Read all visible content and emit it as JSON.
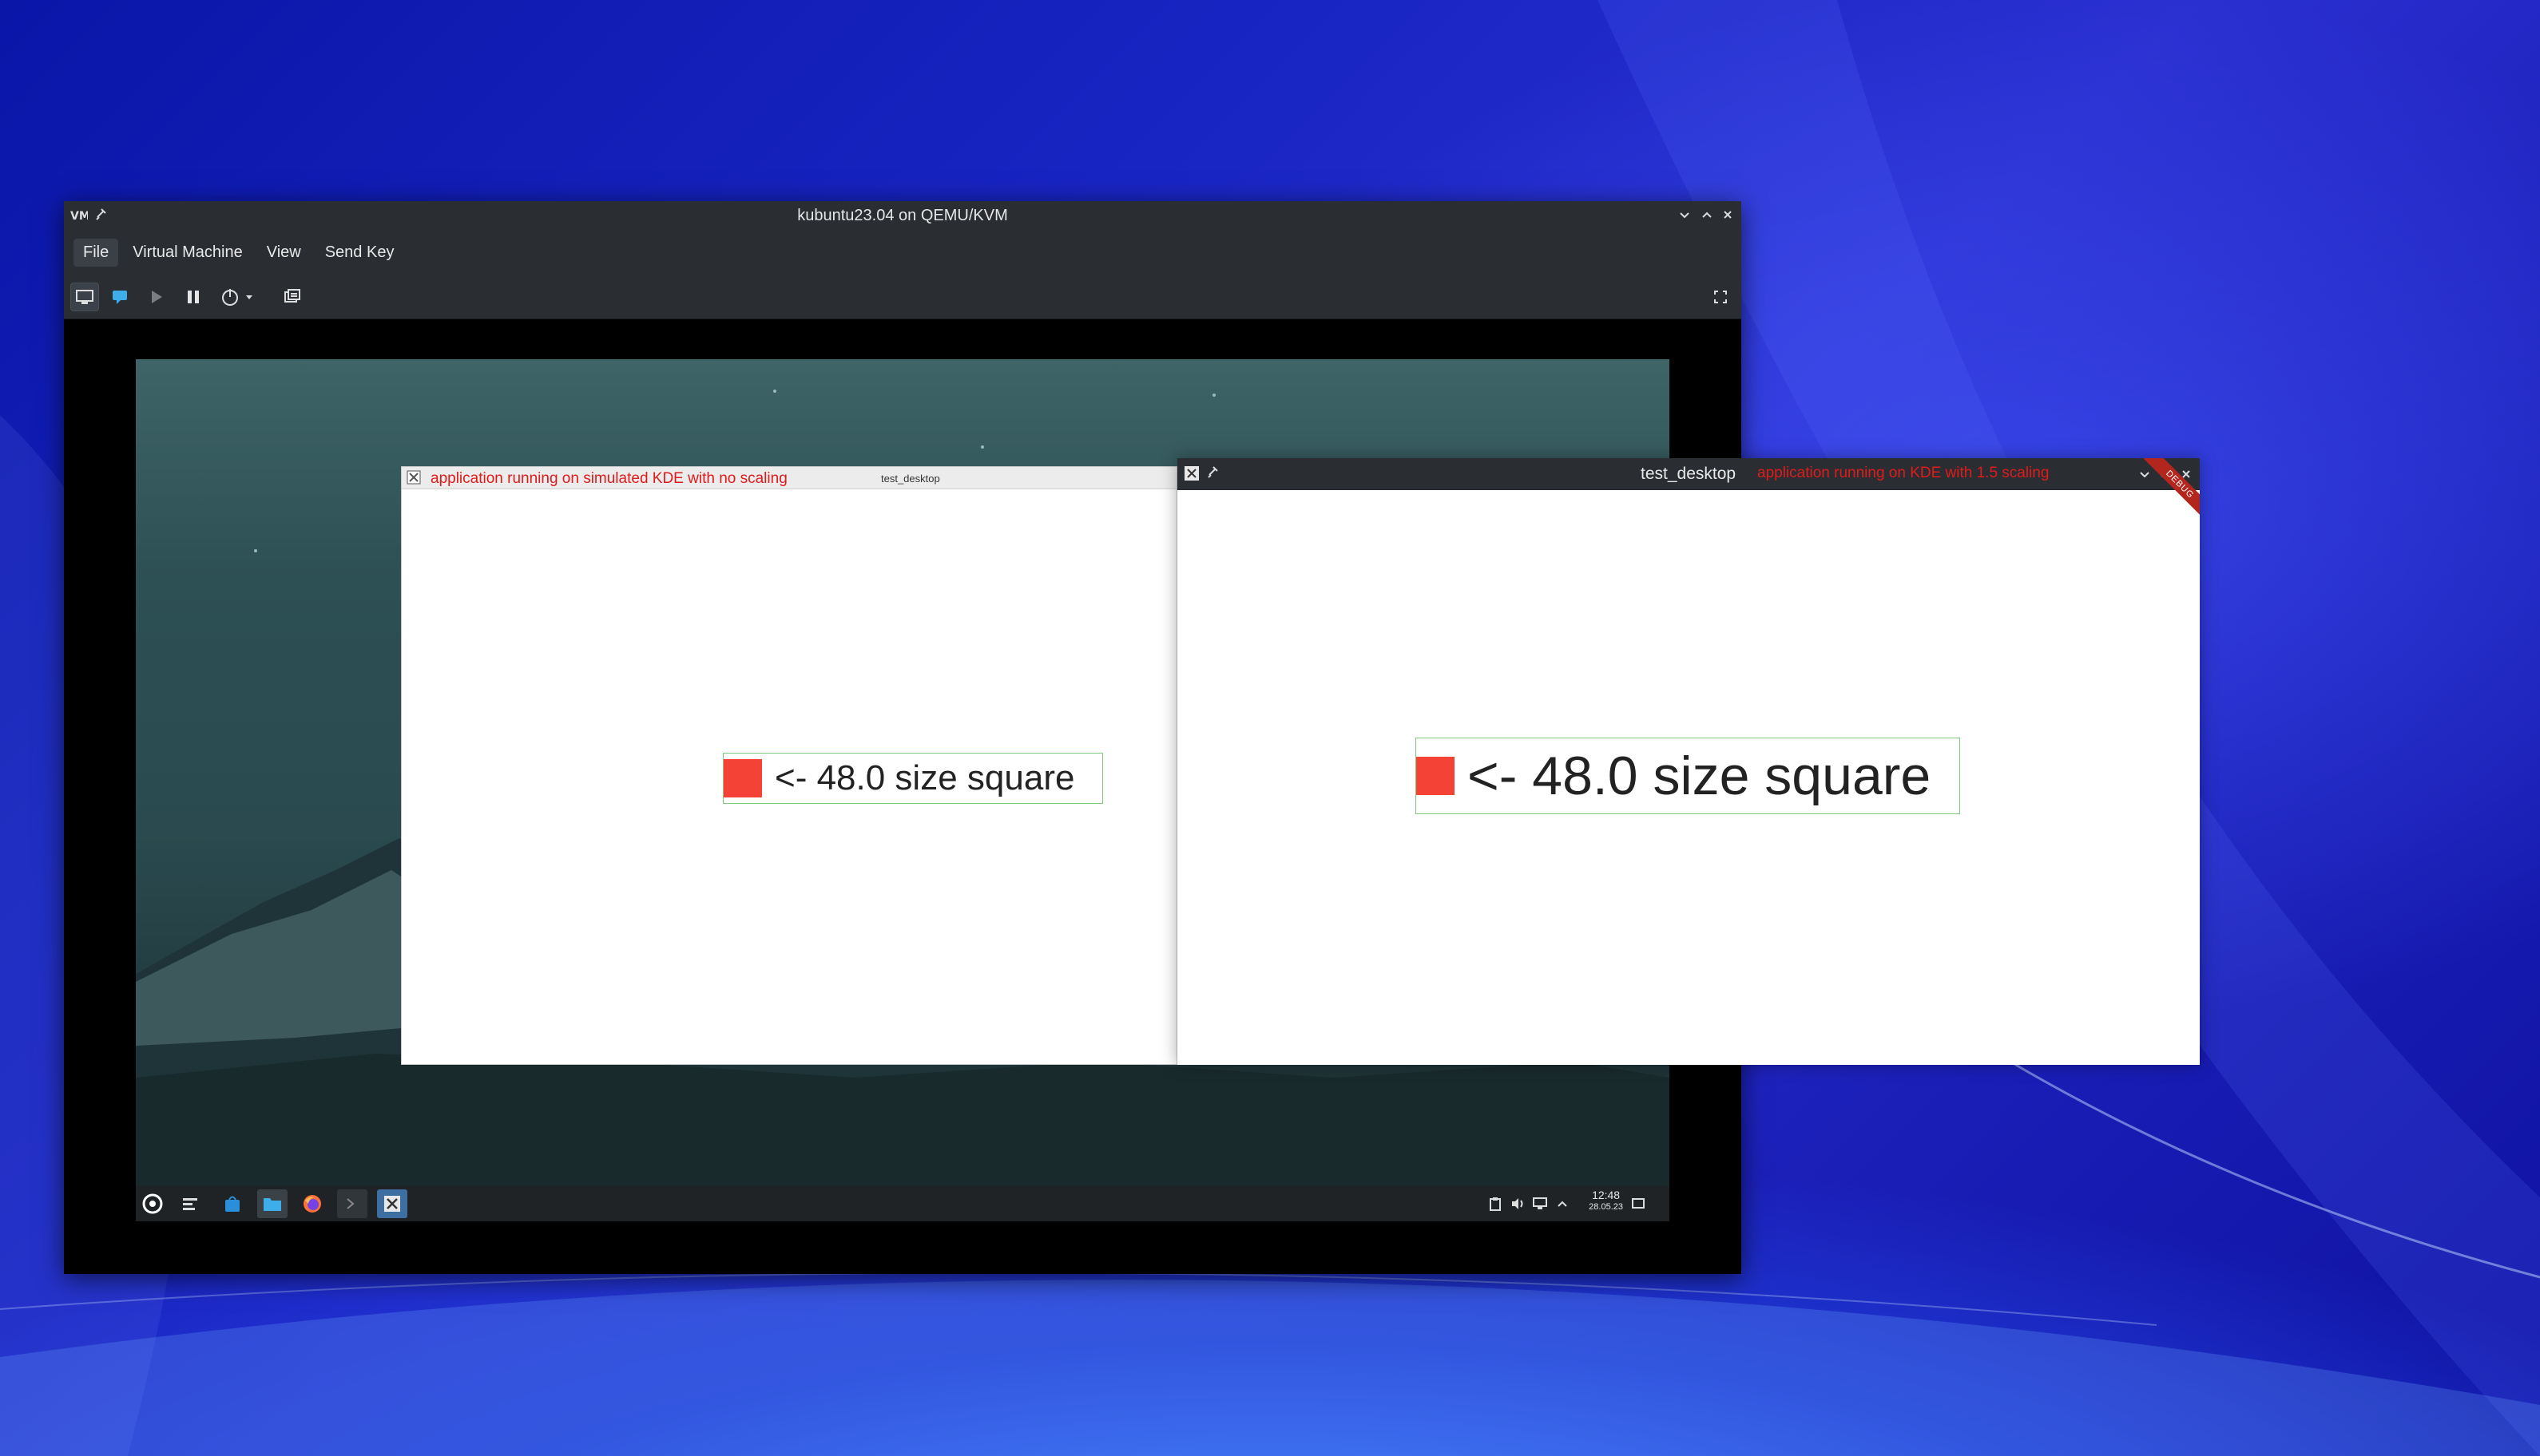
{
  "colors": {
    "accent_red": "#f44336",
    "note_red": "#e01b1b",
    "frame_green": "#7fc97f",
    "titlebar_dark": "#2a2e32"
  },
  "vm_window": {
    "title": "kubuntu23.04 on QEMU/KVM",
    "menu": [
      "File",
      "Virtual Machine",
      "View",
      "Send Key"
    ],
    "toolbar_icons": [
      "monitor-icon",
      "console-icon",
      "play-icon",
      "pause-icon",
      "power-icon",
      "dropdown-arrow-icon",
      "snapshot-icon",
      "fullscreen-icon"
    ]
  },
  "guest": {
    "clock": {
      "time": "12:48",
      "date": "28.05.23"
    },
    "taskbar_icons": [
      "app-launcher-icon",
      "task-manager-icon",
      "discover-icon",
      "dolphin-icon",
      "firefox-icon",
      "konsole-icon",
      "x-app-icon"
    ],
    "tray_icons": [
      "clipboard-icon",
      "volume-icon",
      "network-icon",
      "tray-expand-icon",
      "show-desktop-icon"
    ]
  },
  "left_app": {
    "note": "application running on simulated KDE with no scaling",
    "title": "test_desktop",
    "label": "<- 48.0 size square"
  },
  "right_app": {
    "title": "test_desktop",
    "note": "application running on KDE with 1.5 scaling",
    "label": "<- 48.0 size square",
    "banner": "DEBUG"
  }
}
